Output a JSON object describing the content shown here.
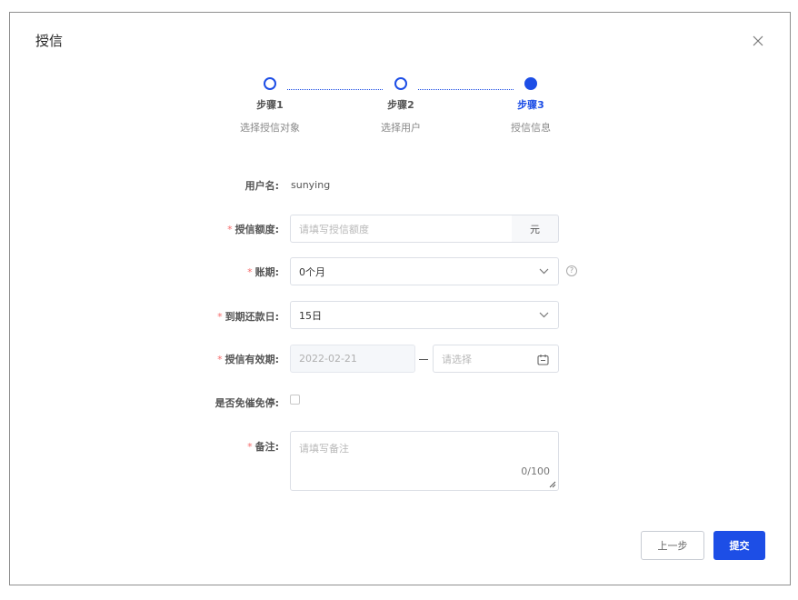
{
  "dialog": {
    "title": "授信",
    "close_icon": "close-icon"
  },
  "steps": [
    {
      "name": "步骤1",
      "desc": "选择授信对象",
      "active": false
    },
    {
      "name": "步骤2",
      "desc": "选择用户",
      "active": false
    },
    {
      "name": "步骤3",
      "desc": "授信信息",
      "active": true
    }
  ],
  "form": {
    "username": {
      "label": "用户名:",
      "value": "sunying"
    },
    "credit_amount": {
      "label": "授信额度:",
      "placeholder": "请填写授信额度",
      "unit": "元"
    },
    "term": {
      "label": "账期:",
      "value": "0个月",
      "help_icon": "question-circle-icon"
    },
    "due_day": {
      "label": "到期还款日:",
      "value": "15日"
    },
    "validity": {
      "label": "授信有效期:",
      "start": "2022-02-21",
      "end_placeholder": "请选择",
      "calendar_icon": "calendar-icon"
    },
    "exempt": {
      "label": "是否免催免停:",
      "checked": false
    },
    "remark": {
      "label": "备注:",
      "placeholder": "请填写备注",
      "count": "0/100"
    }
  },
  "footer": {
    "prev_label": "上一步",
    "submit_label": "提交"
  },
  "colors": {
    "primary": "#1d4ee6",
    "required": "#f56c6c"
  }
}
